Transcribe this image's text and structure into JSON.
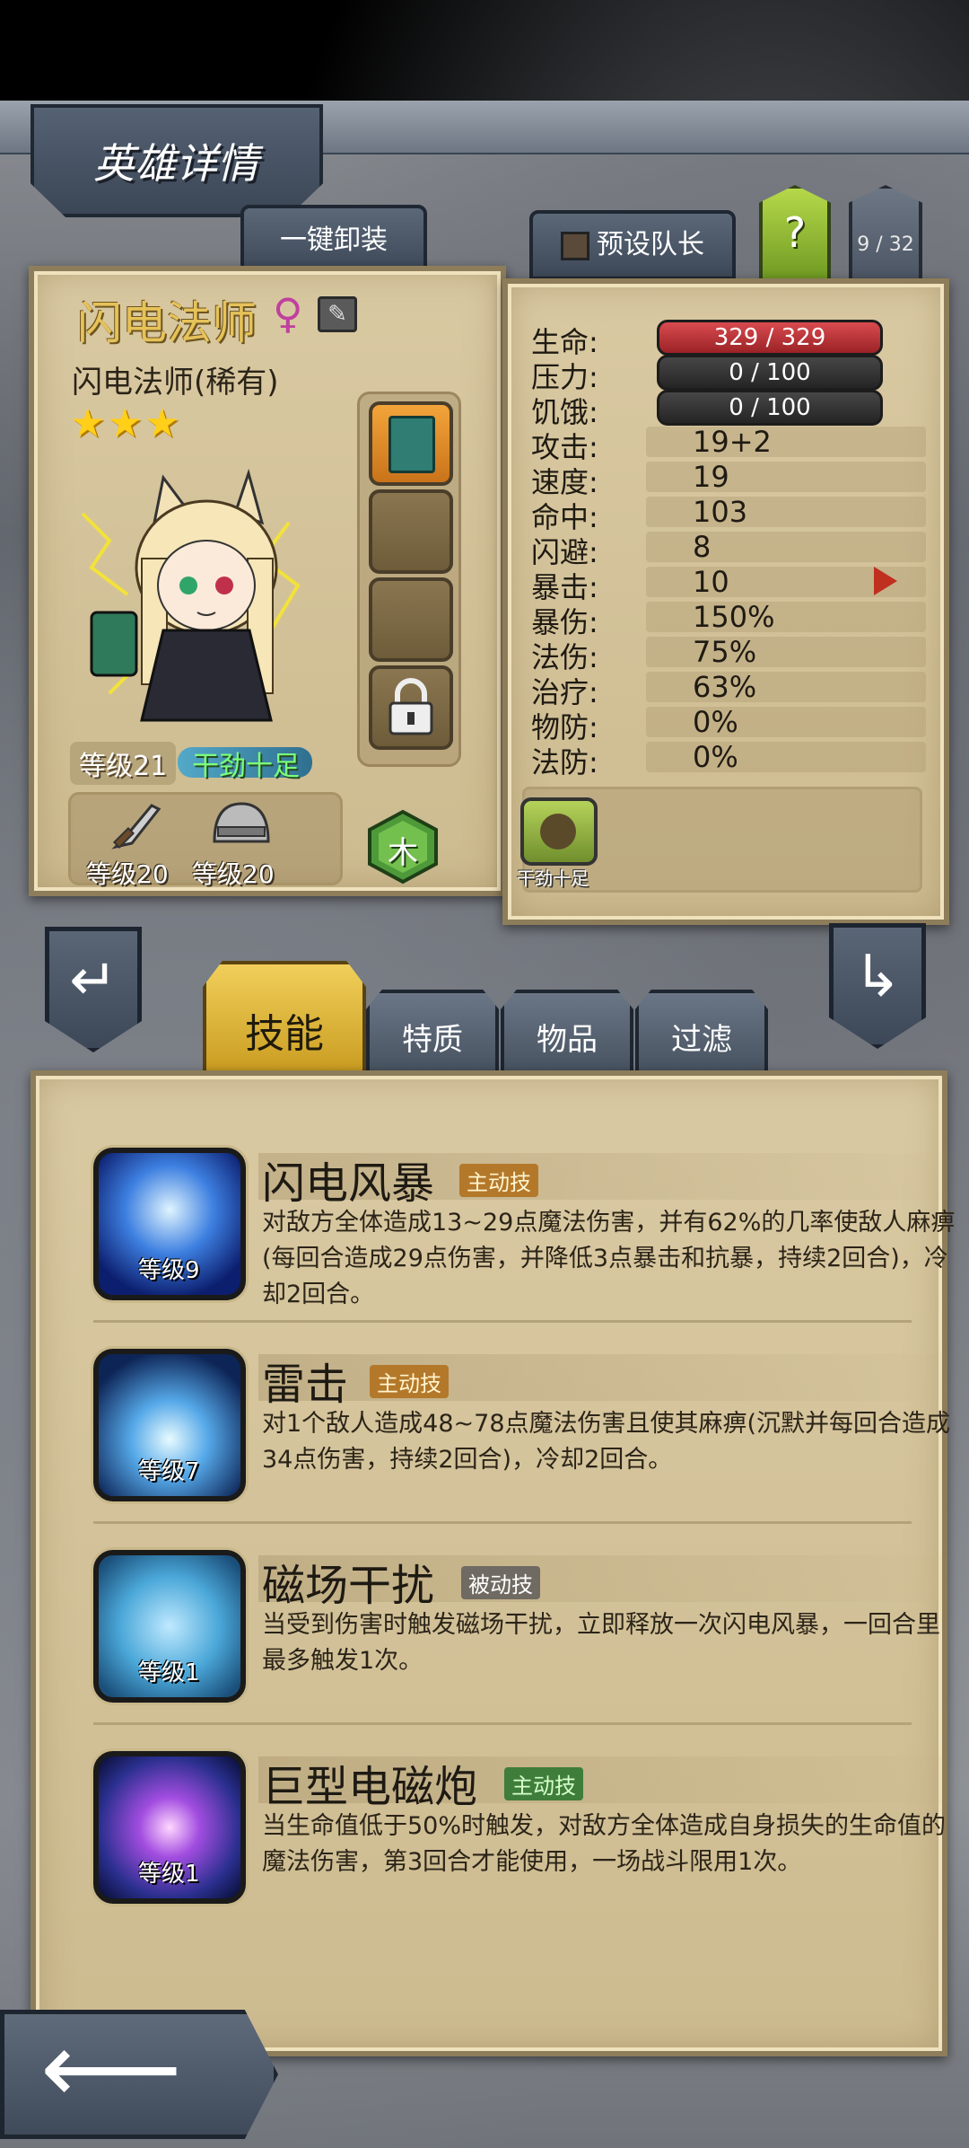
{
  "header": {
    "title": "英雄详情"
  },
  "toolbar": {
    "unequip_all": "一键卸装",
    "preset_captain": "预设队长",
    "help": "?",
    "roster_count": "9 / 32"
  },
  "hero": {
    "name": "闪电法师",
    "gender_symbol": "♀",
    "subtitle": "闪电法师(稀有)",
    "stars": "★★★",
    "level": "等级21",
    "status": "干劲十足",
    "weapon_level": "等级20",
    "armor_level": "等级20",
    "element": "木"
  },
  "stats": [
    {
      "label": "生命:",
      "value": "329 / 329",
      "kind": "bar-red"
    },
    {
      "label": "压力:",
      "value": "0 / 100",
      "kind": "bar-dark"
    },
    {
      "label": "饥饿:",
      "value": "0 / 100",
      "kind": "bar-dark"
    },
    {
      "label": "攻击:",
      "value": "19+2"
    },
    {
      "label": "速度:",
      "value": "19"
    },
    {
      "label": "命中:",
      "value": "103"
    },
    {
      "label": "闪避:",
      "value": "8"
    },
    {
      "label": "暴击:",
      "value": "10"
    },
    {
      "label": "暴伤:",
      "value": "150%"
    },
    {
      "label": "法伤:",
      "value": "75%"
    },
    {
      "label": "治疗:",
      "value": "63%"
    },
    {
      "label": "物防:",
      "value": "0%"
    },
    {
      "label": "法防:",
      "value": "0%"
    }
  ],
  "trait": {
    "label": "干劲十足"
  },
  "tabs": [
    "技能",
    "特质",
    "物品",
    "过滤"
  ],
  "skills": [
    {
      "name": "闪电风暴",
      "tag": "主动技",
      "level": "等级9",
      "desc": "对敌方全体造成13~29点魔法伤害，并有62%的几率使敌人麻痹(每回合造成29点伤害，并降低3点暴击和抗暴，持续2回合)，冷却2回合。"
    },
    {
      "name": "雷击",
      "tag": "主动技",
      "level": "等级7",
      "desc": "对1个敌人造成48~78点魔法伤害且使其麻痹(沉默并每回合造成34点伤害，持续2回合)，冷却2回合。"
    },
    {
      "name": "磁场干扰",
      "tag": "被动技",
      "level": "等级1",
      "desc": "当受到伤害时触发磁场干扰，立即释放一次闪电风暴，一回合里最多触发1次。"
    },
    {
      "name": "巨型电磁炮",
      "tag": "主动技",
      "level": "等级1",
      "desc": "当生命值低于50%时触发，对敌方全体造成自身损失的生命值的魔法伤害，第3回合才能使用，一场战斗限用1次。"
    }
  ],
  "nav": {
    "prev": "↵",
    "next": "↳",
    "back": "⟵"
  }
}
